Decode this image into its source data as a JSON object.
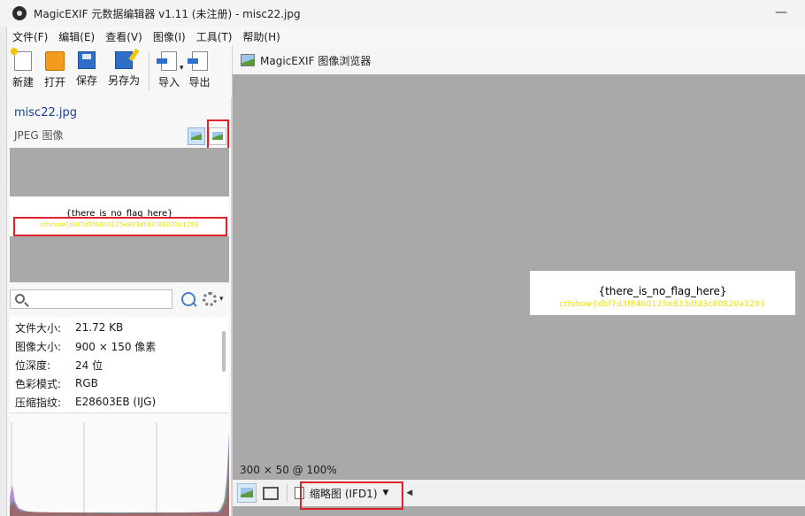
{
  "window": {
    "title": "MagicEXIF 元数据编辑器 v1.11 (未注册) - misc22.jpg",
    "minimize": "—"
  },
  "menu": [
    "文件(F)",
    "编辑(E)",
    "查看(V)",
    "图像(I)",
    "工具(T)",
    "帮助(H)"
  ],
  "toolbar": {
    "new": "新建",
    "open": "打开",
    "save": "保存",
    "save_as": "另存为",
    "import": "导入",
    "import_arrow": "▾",
    "export": "导出"
  },
  "file": {
    "name": "misc22.jpg",
    "type": "JPEG 图像"
  },
  "preview": {
    "line1": "{there_is_no_flag_here}",
    "line2": "ctfshow{dbf7d3f84b0125e833dfd3c80820a129}"
  },
  "search": {
    "placeholder": "",
    "gear_arrow": "▾"
  },
  "properties": [
    {
      "key": "文件大小:",
      "value": "21.72 KB"
    },
    {
      "key": "图像大小:",
      "value": "900 × 150 像素"
    },
    {
      "key": "位深度:",
      "value": "24 位"
    },
    {
      "key": "色彩模式:",
      "value": "RGB"
    },
    {
      "key": "压缩指纹:",
      "value": "E28603EB (IJG)"
    }
  ],
  "viewer": {
    "title": "MagicEXIF 图像浏览器",
    "image_line1": "{there_is_no_flag_here}",
    "image_line2": "ctfshow{dbf7d3f84b0125e833dfd3c80820a129}",
    "dims": "300 × 50 @ 100%",
    "select": "缩略图 (IFD1)",
    "select_caret": "▼",
    "left_arrow": "◀"
  },
  "colors": {
    "highlight": "#e0202a",
    "flag_text": "#f0e000",
    "canvas_gray": "#a9a9a9"
  }
}
